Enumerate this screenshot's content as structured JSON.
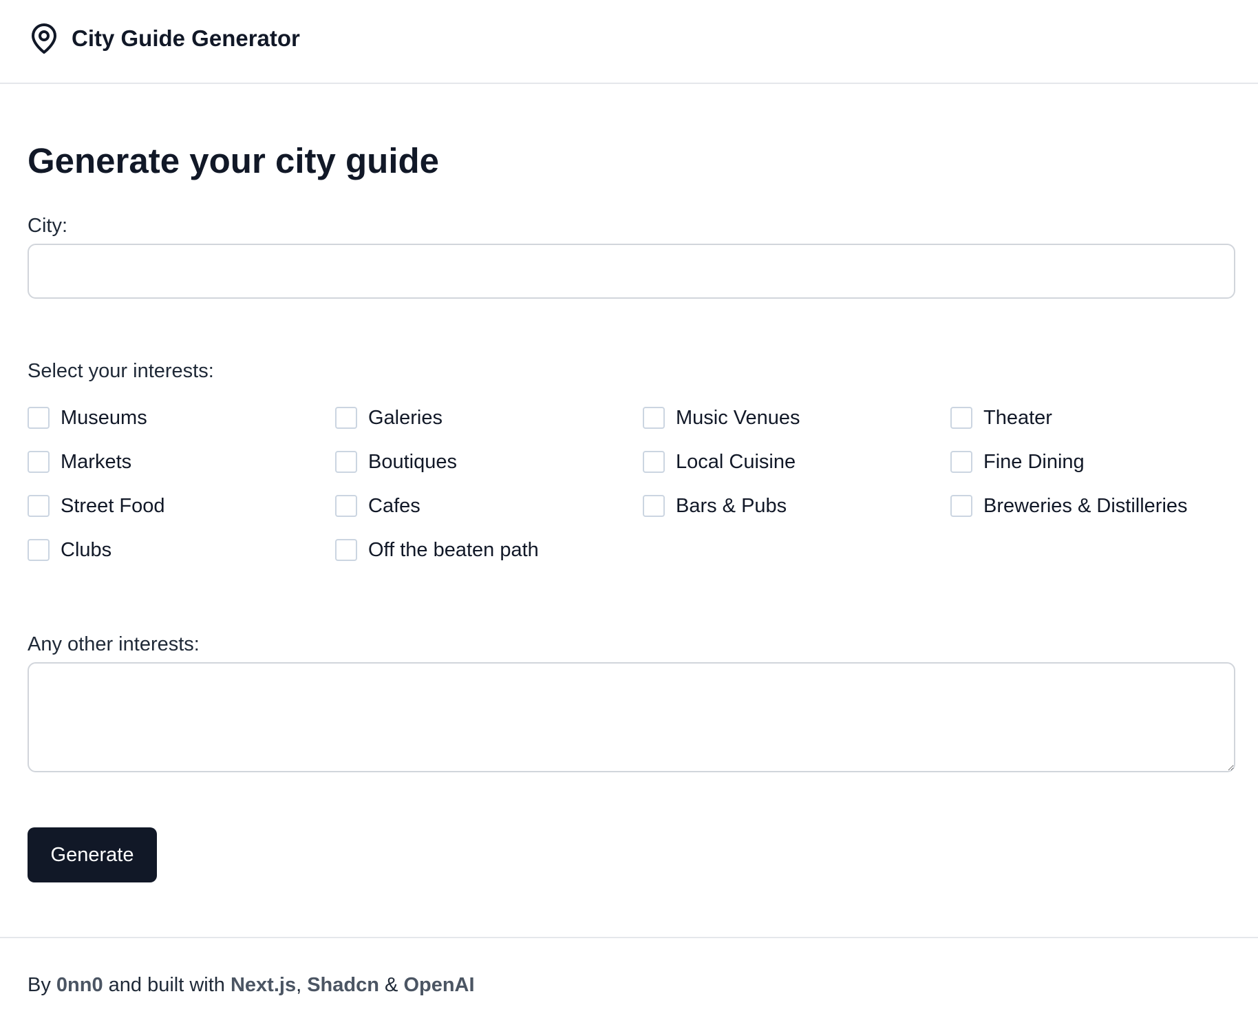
{
  "header": {
    "icon": "map-pin-icon",
    "title": "City Guide Generator"
  },
  "main": {
    "title": "Generate your city guide",
    "city": {
      "label": "City:",
      "value": "",
      "placeholder": ""
    },
    "interests": {
      "label": "Select your interests:",
      "options": [
        {
          "label": "Museums",
          "checked": false
        },
        {
          "label": "Galeries",
          "checked": false
        },
        {
          "label": "Music Venues",
          "checked": false
        },
        {
          "label": "Theater",
          "checked": false
        },
        {
          "label": "Markets",
          "checked": false
        },
        {
          "label": "Boutiques",
          "checked": false
        },
        {
          "label": "Local Cuisine",
          "checked": false
        },
        {
          "label": "Fine Dining",
          "checked": false
        },
        {
          "label": "Street Food",
          "checked": false
        },
        {
          "label": "Cafes",
          "checked": false
        },
        {
          "label": "Bars & Pubs",
          "checked": false
        },
        {
          "label": "Breweries & Distilleries",
          "checked": false
        },
        {
          "label": "Clubs",
          "checked": false
        },
        {
          "label": "Off the beaten path",
          "checked": false
        }
      ]
    },
    "other": {
      "label": "Any other interests:",
      "value": "",
      "placeholder": ""
    },
    "generate_label": "Generate"
  },
  "footer": {
    "prefix": "By ",
    "author": "0nn0",
    "middle": " and built with ",
    "link1": "Next.js",
    "sep1": ", ",
    "link2": "Shadcn",
    "sep2": " & ",
    "link3": "OpenAI"
  },
  "colors": {
    "primary_button": "#111827",
    "border": "#d1d5db",
    "link": "#4b5563"
  }
}
